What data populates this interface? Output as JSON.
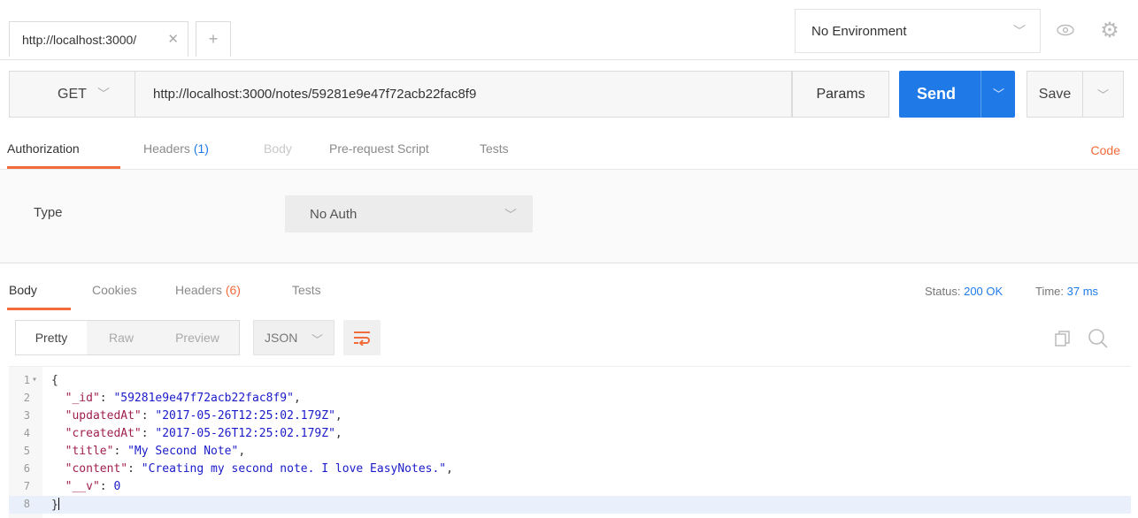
{
  "tabs": [
    {
      "label": "http://localhost:3000/"
    }
  ],
  "environment": {
    "selected": "No Environment"
  },
  "request": {
    "method": "GET",
    "url": "http://localhost:3000/notes/59281e9e47f72acb22fac8f9",
    "params_label": "Params",
    "send_label": "Send",
    "save_label": "Save"
  },
  "request_tabs": {
    "authorization": "Authorization",
    "headers": "Headers",
    "headers_count": "(1)",
    "body": "Body",
    "prerequest": "Pre-request Script",
    "tests": "Tests",
    "code": "Code"
  },
  "auth": {
    "type_label": "Type",
    "type_value": "No Auth"
  },
  "response_tabs": {
    "body": "Body",
    "cookies": "Cookies",
    "headers": "Headers",
    "headers_count": "(6)",
    "tests": "Tests"
  },
  "response_status": {
    "status_label": "Status:",
    "status_value": "200 OK",
    "time_label": "Time:",
    "time_value": "37 ms"
  },
  "format": {
    "pretty": "Pretty",
    "raw": "Raw",
    "preview": "Preview",
    "lang": "JSON"
  },
  "body_lines": [
    {
      "num": "1"
    },
    {
      "num": "2",
      "key": "\"_id\"",
      "value": "\"59281e9e47f72acb22fac8f9\""
    },
    {
      "num": "3",
      "key": "\"updatedAt\"",
      "value": "\"2017-05-26T12:25:02.179Z\""
    },
    {
      "num": "4",
      "key": "\"createdAt\"",
      "value": "\"2017-05-26T12:25:02.179Z\""
    },
    {
      "num": "5",
      "key": "\"title\"",
      "value": "\"My Second Note\""
    },
    {
      "num": "6",
      "key": "\"content\"",
      "value": "\"Creating my second note. I love EasyNotes.\""
    },
    {
      "num": "7",
      "key": "\"__v\"",
      "value": "0"
    },
    {
      "num": "8"
    }
  ]
}
